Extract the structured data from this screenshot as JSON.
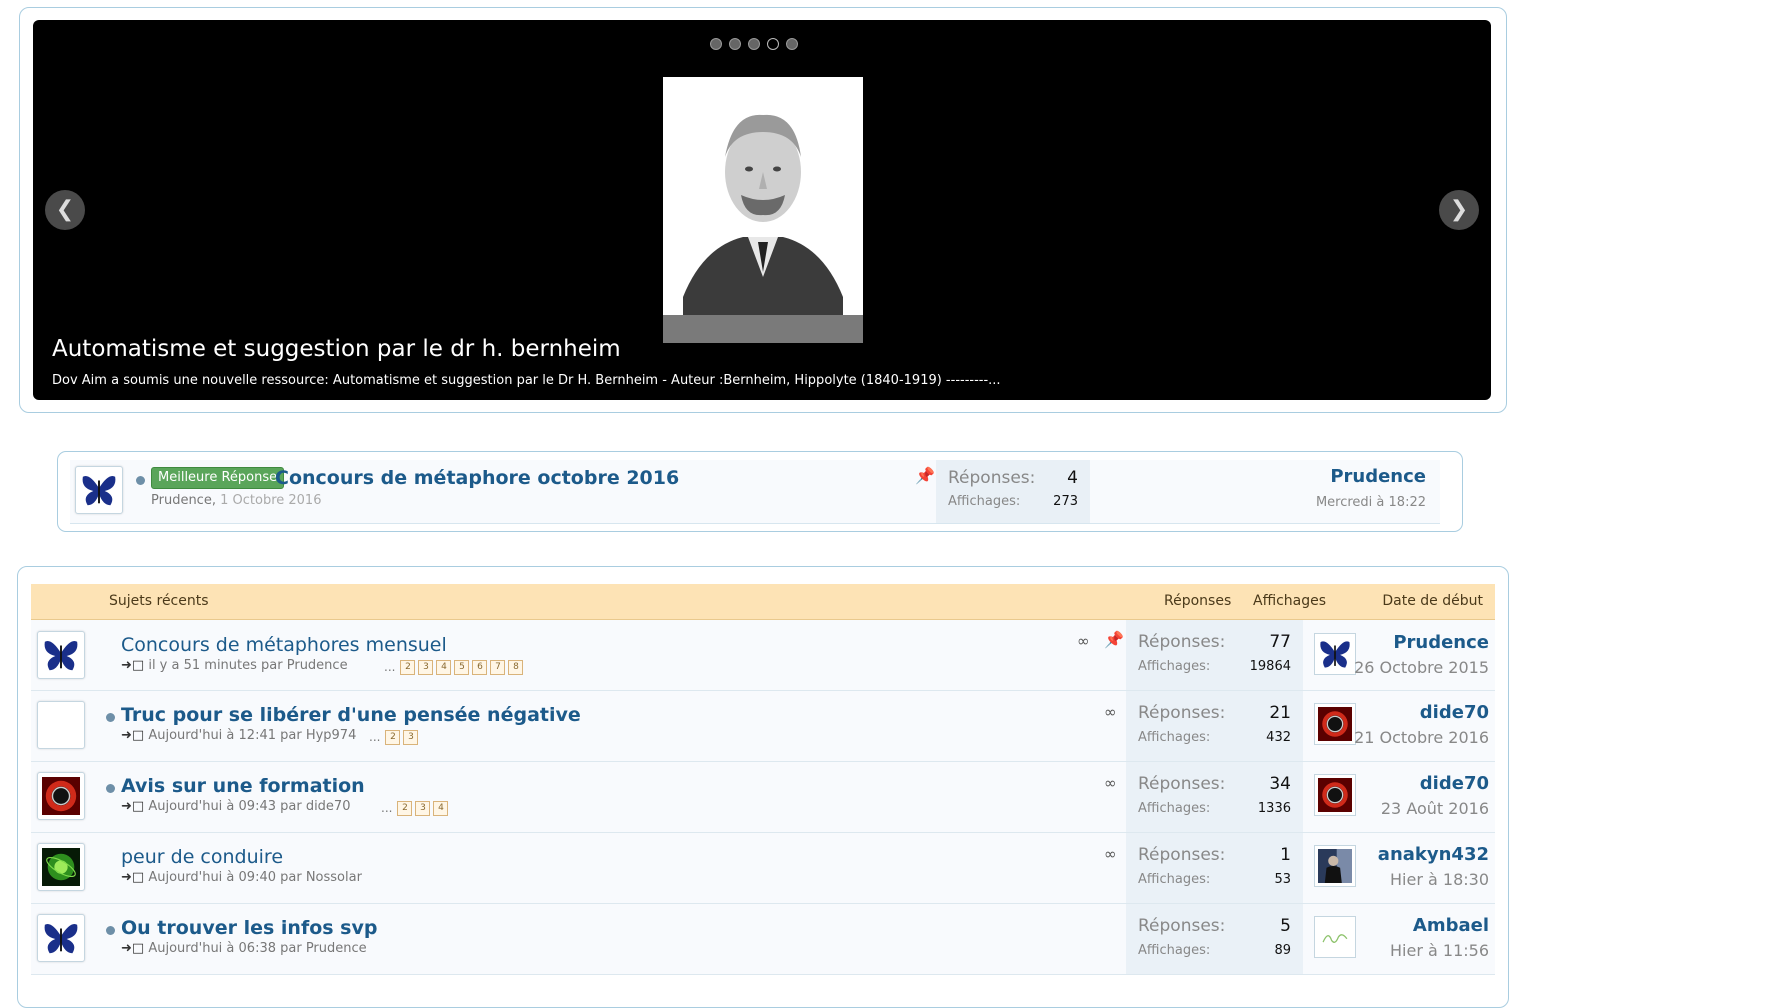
{
  "slider": {
    "title": "Automatisme et suggestion par le dr h. bernheim",
    "excerpt": "Dov Aim a soumis une nouvelle ressource: Automatisme et suggestion par le Dr H. Bernheim - Auteur :Bernheim, Hippolyte (1840-1919) ---------...",
    "prev_icon": "chevron-left-icon",
    "next_icon": "chevron-right-icon",
    "dot_count": 5,
    "active_dot": 4
  },
  "sticky": {
    "prefix": "Meilleure Réponse",
    "title": "Concours de métaphore octobre 2016",
    "author": "Prudence",
    "date": "1 Octobre 2016",
    "replies_label": "Réponses:",
    "replies": "4",
    "views_label": "Affichages:",
    "views": "273",
    "last_user": "Prudence",
    "last_date": "Mercredi à 18:22"
  },
  "recent": {
    "header": {
      "title": "Sujets récents",
      "replies": "Réponses",
      "views": "Affichages",
      "start_date": "Date de début"
    },
    "topics": [
      {
        "title": "Concours de métaphores mensuel",
        "meta": "il y a 51 minutes par Prudence",
        "pages": [
          "2",
          "3",
          "4",
          "5",
          "6",
          "7",
          "8"
        ],
        "replies_label": "Réponses:",
        "replies": "77",
        "views_label": "Affichages:",
        "views": "19864",
        "starter": "Prudence",
        "start_date": "26 Octobre 2015"
      },
      {
        "title": "Truc pour se libérer d'une pensée négative",
        "meta": "Aujourd'hui à 12:41 par Hyp974",
        "pages": [
          "2",
          "3"
        ],
        "replies_label": "Réponses:",
        "replies": "21",
        "views_label": "Affichages:",
        "views": "432",
        "starter": "dide70",
        "start_date": "21 Octobre 2016"
      },
      {
        "title": "Avis sur une formation",
        "meta": "Aujourd'hui à 09:43 par dide70",
        "pages": [
          "2",
          "3",
          "4"
        ],
        "replies_label": "Réponses:",
        "replies": "34",
        "views_label": "Affichages:",
        "views": "1336",
        "starter": "dide70",
        "start_date": "23 Août 2016"
      },
      {
        "title": "peur de conduire",
        "meta": "Aujourd'hui à 09:40 par Nossolar",
        "pages": [],
        "replies_label": "Réponses:",
        "replies": "1",
        "views_label": "Affichages:",
        "views": "53",
        "starter": "anakyn432",
        "start_date": "Hier à 18:30"
      },
      {
        "title": "Ou trouver les infos svp",
        "meta": "Aujourd'hui à 06:38 par Prudence",
        "pages": [],
        "replies_label": "Réponses:",
        "replies": "5",
        "views_label": "Affichages:",
        "views": "89",
        "starter": "Ambael",
        "start_date": "Hier à 11:56"
      }
    ]
  }
}
